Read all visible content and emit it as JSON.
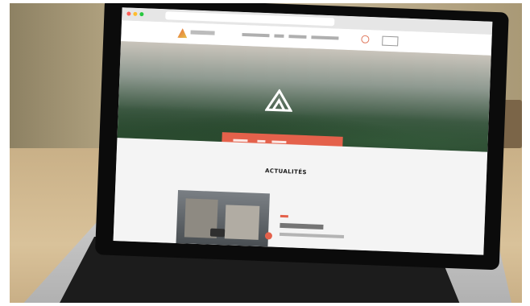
{
  "website": {
    "section_title": "ACTUALITÉS"
  },
  "icons": {
    "logo": "triangle-logo-icon",
    "hero_logo": "mountain-logo-icon",
    "search": "search-icon"
  },
  "colors": {
    "accent": "#e4614b",
    "logo_gradient_start": "#e86b3a",
    "logo_gradient_end": "#e6c14a"
  }
}
